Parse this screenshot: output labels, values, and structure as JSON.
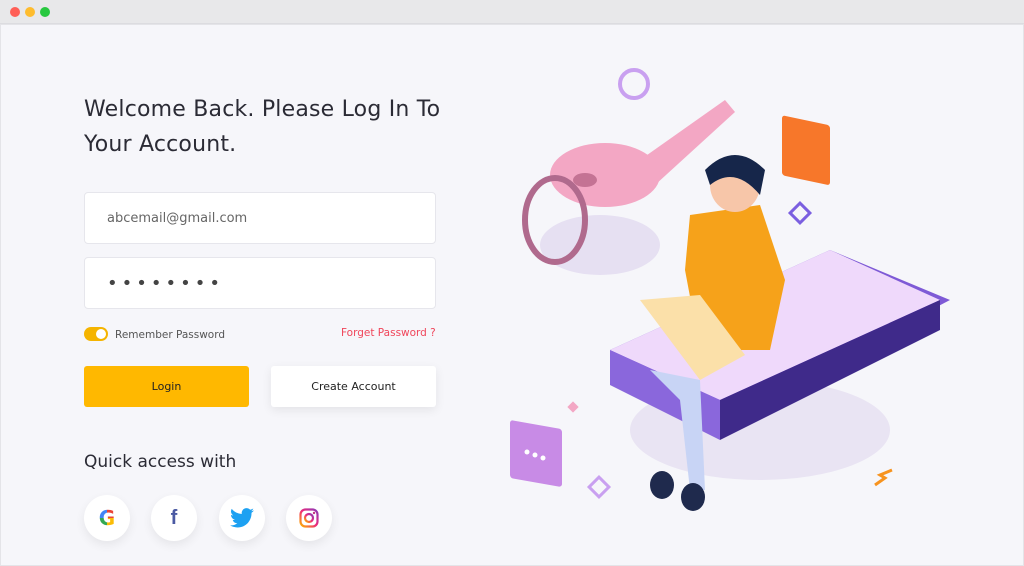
{
  "window": {
    "controls": [
      "close",
      "minimize",
      "maximize"
    ],
    "colors": {
      "close": "#ff5f57",
      "minimize": "#febc2e",
      "maximize": "#28c840"
    }
  },
  "heading": "Welcome Back. Please Log In To Your Account.",
  "form": {
    "email_value": "abcemail@gmail.com",
    "password_value": "••••••••",
    "remember_label": "Remember Password",
    "remember_on": true,
    "forgot_label": "Forget Password ?",
    "login_label": "Login",
    "create_label": "Create Account"
  },
  "quick": {
    "label": "Quick access with",
    "icons": [
      "google-icon",
      "facebook-icon",
      "twitter-icon",
      "instagram-icon"
    ]
  },
  "colors": {
    "accent": "#ffb800",
    "link": "#f0455a"
  }
}
